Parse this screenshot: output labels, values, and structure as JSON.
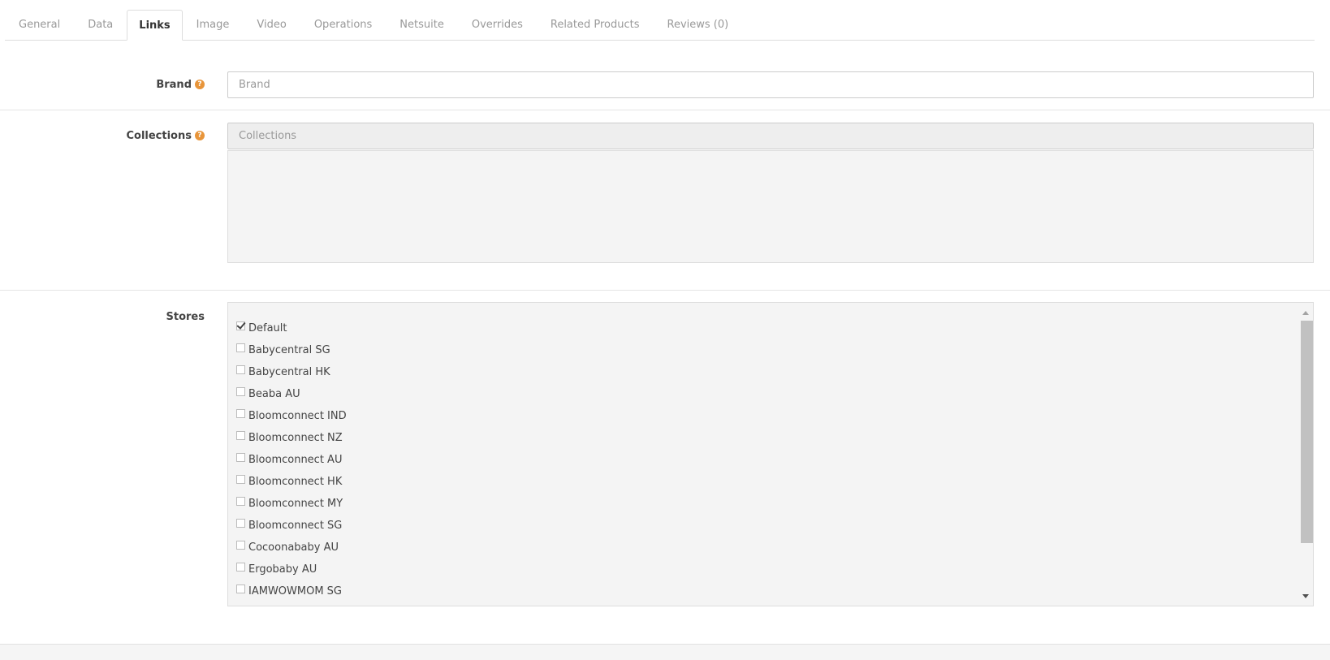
{
  "tabs": [
    {
      "label": "General"
    },
    {
      "label": "Data"
    },
    {
      "label": "Links",
      "active": true
    },
    {
      "label": "Image"
    },
    {
      "label": "Video"
    },
    {
      "label": "Operations"
    },
    {
      "label": "Netsuite"
    },
    {
      "label": "Overrides"
    },
    {
      "label": "Related Products"
    },
    {
      "label": "Reviews (0)"
    }
  ],
  "brand": {
    "label": "Brand",
    "value": "",
    "placeholder": "Brand",
    "help_icon": "question-icon"
  },
  "collections": {
    "label": "Collections",
    "value": "",
    "placeholder": "Collections",
    "help_icon": "question-icon"
  },
  "stores": {
    "label": "Stores",
    "items": [
      {
        "label": "Default",
        "checked": true
      },
      {
        "label": "Babycentral SG",
        "checked": false
      },
      {
        "label": "Babycentral HK",
        "checked": false
      },
      {
        "label": "Beaba AU",
        "checked": false
      },
      {
        "label": "Bloomconnect IND",
        "checked": false
      },
      {
        "label": "Bloomconnect NZ",
        "checked": false
      },
      {
        "label": "Bloomconnect AU",
        "checked": false
      },
      {
        "label": "Bloomconnect HK",
        "checked": false
      },
      {
        "label": "Bloomconnect MY",
        "checked": false
      },
      {
        "label": "Bloomconnect SG",
        "checked": false
      },
      {
        "label": "Cocoonababy AU",
        "checked": false
      },
      {
        "label": "Ergobaby AU",
        "checked": false
      },
      {
        "label": "IAMWOWMOM SG",
        "checked": false
      }
    ]
  },
  "colors": {
    "help_icon": "#e8953a",
    "active_tab_text": "#333333",
    "inactive_tab_text": "#999999"
  }
}
